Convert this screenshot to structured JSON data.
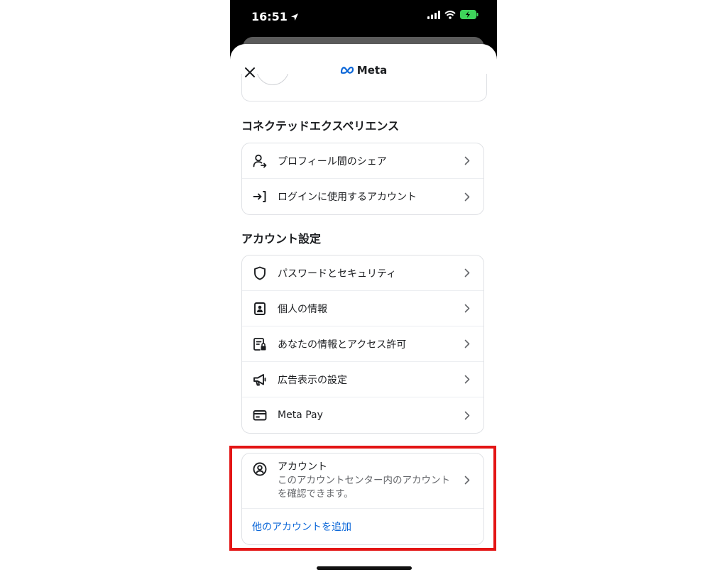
{
  "status_bar": {
    "time": "16:51"
  },
  "header": {
    "brand": "Meta"
  },
  "sections": {
    "connected": {
      "title": "コネクテッドエクスペリエンス",
      "items": [
        {
          "label": "プロフィール間のシェア",
          "icon": "profile-share-icon"
        },
        {
          "label": "ログインに使用するアカウント",
          "icon": "login-icon"
        }
      ]
    },
    "account_settings": {
      "title": "アカウント設定",
      "items": [
        {
          "label": "パスワードとセキュリティ",
          "icon": "shield-icon"
        },
        {
          "label": "個人の情報",
          "icon": "id-card-icon"
        },
        {
          "label": "あなたの情報とアクセス許可",
          "icon": "document-lock-icon"
        },
        {
          "label": "広告表示の設定",
          "icon": "megaphone-icon"
        },
        {
          "label": "Meta Pay",
          "icon": "card-icon"
        }
      ]
    },
    "accounts": {
      "title": "アカウント",
      "description": "このアカウントセンター内のアカウントを確認できます。",
      "add_link": "他のアカウントを追加"
    }
  },
  "colors": {
    "highlight": "#e31414",
    "link": "#0a66d8"
  }
}
